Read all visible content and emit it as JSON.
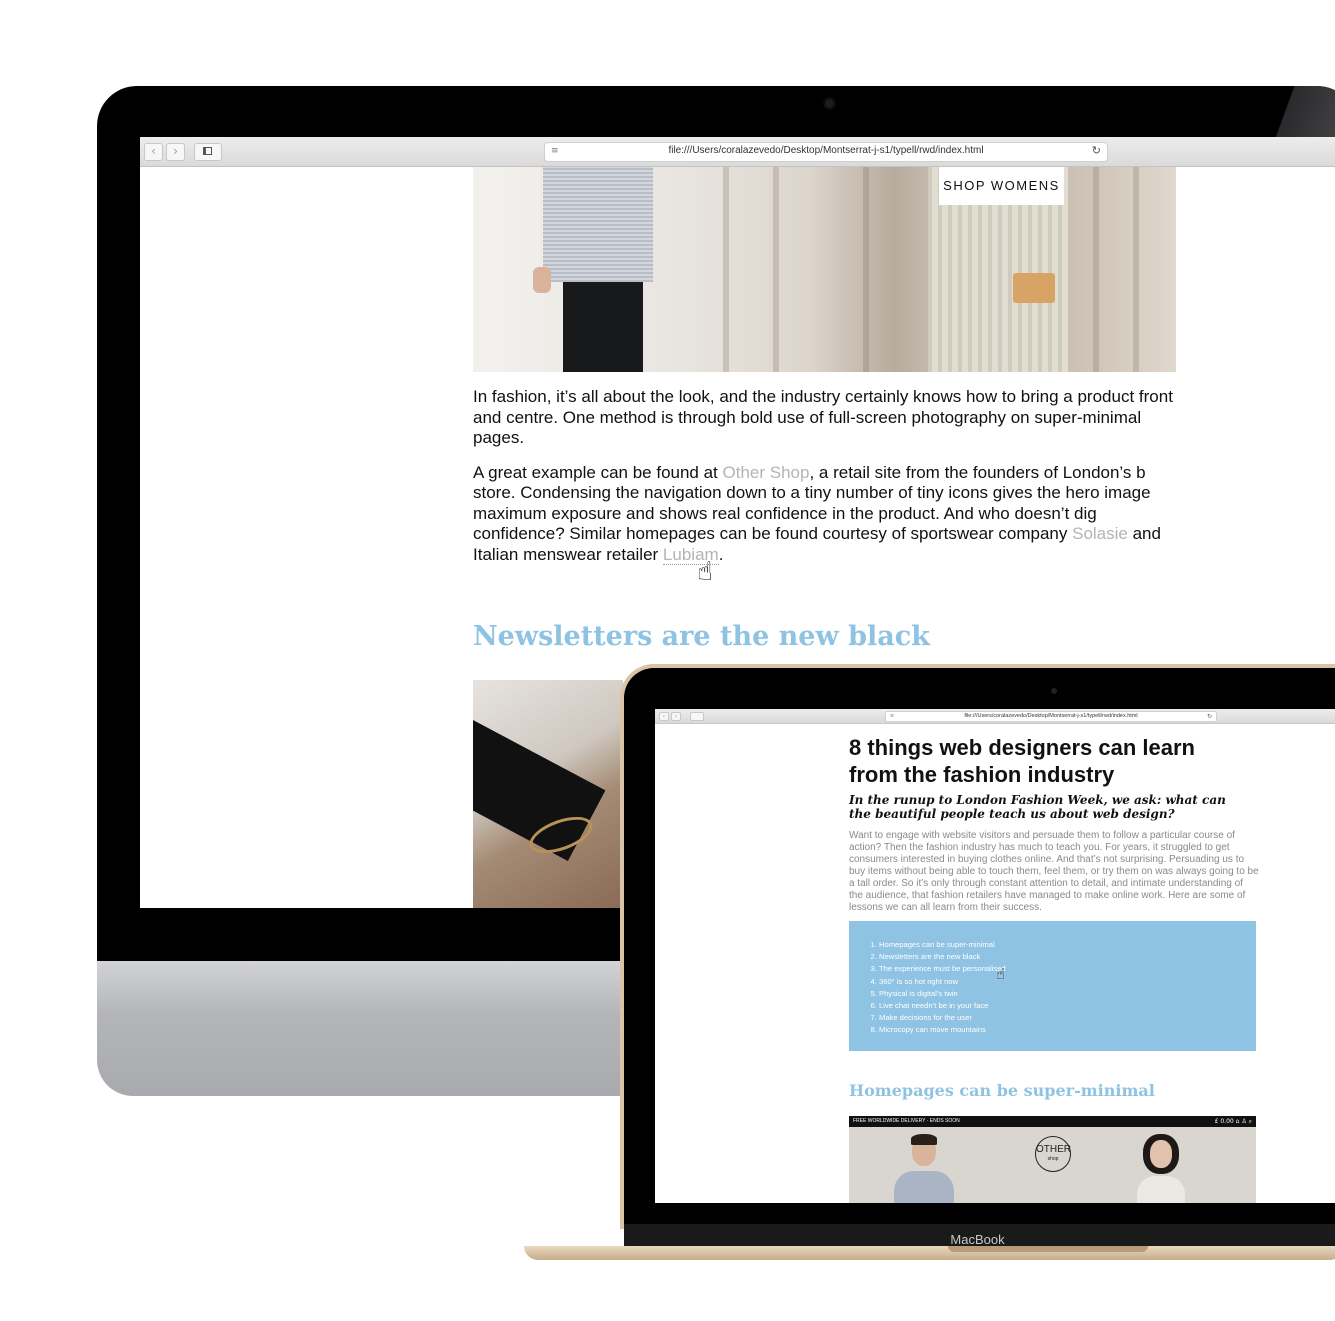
{
  "imac": {
    "browser": {
      "back_icon": "‹",
      "forward_icon": "›",
      "url": "file:///Users/coralazevedo/Desktop/Montserrat-j-s1/typell/rwd/index.html",
      "reader_icon": "≡",
      "reload_icon": "↻"
    },
    "hero": {
      "shop_button": "SHOP WOMENS"
    },
    "article": {
      "p1": "In fashion, it’s all about the look, and the industry certainly knows how to bring a product front and centre. One method is through bold use of full-screen photography on super-minimal pages.",
      "p2_a": "A great example can be found at ",
      "p2_link1": "Other Shop",
      "p2_b": ", a retail site from the founders of London’s b store. Condensing the navigation down to a tiny number of tiny icons gives the hero image maximum exposure and shows real confidence in the product. And who doesn’t dig confidence? Similar homepages can be found courtesy of sportswear company ",
      "p2_link2": "Solasie",
      "p2_c": " and Italian menswear retailer ",
      "p2_link3": "Lubiam",
      "p2_d": "."
    },
    "section_heading": "Newsletters are the new black"
  },
  "macbook": {
    "brand": "MacBook",
    "browser": {
      "url": "file:///Users/coralazevedo/Desktop/Montserrat-j-s1/typell/rwd/index.html"
    },
    "title": "8 things web designers can learn from the fashion industry",
    "subtitle": "In the runup to London Fashion Week, we ask: what can the beautiful people teach us about web design?",
    "intro": "Want to engage with website visitors and persuade them to follow a particular course of action? Then the fashion industry has much to teach you. For years, it struggled to get consumers interested in buying clothes online. And that’s not surprising. Persuading us to buy items without being able to touch them, feel them, or try them on was always going to be a tall order. So it’s only through constant attention to detail, and intimate understanding of the audience, that fashion retailers have managed to make online work. Here are some of lessons we can all learn from their success.",
    "toc": [
      "Homepages can be super-minimal",
      "Newsletters are the new black",
      "The experience must be personalised",
      "360° is so hot right now",
      "Physical is digital’s twin",
      "Live chat needn’t be in your face",
      "Make decisions for the user",
      "Microcopy can move mountains"
    ],
    "section_heading": "Homepages can be super-minimal",
    "screenshot": {
      "banner": "FREE WORLDWIDE DELIVERY · ENDS SOON",
      "icons": "£ 0.00 ⌂ ♙ ⌕",
      "logo_main": "OTHER",
      "logo_sub": "shop"
    }
  },
  "colors": {
    "accent_blue": "#8ec3e3",
    "link_grey": "#b4b4b4",
    "macbook_gold": "#d9c4a8"
  }
}
